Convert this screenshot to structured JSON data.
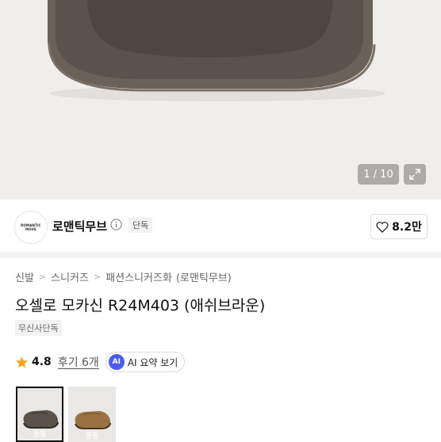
{
  "hero": {
    "image_counter": "1 / 10",
    "expand_icon": "expand-icon"
  },
  "brand": {
    "logo_text_line1": "ROMANTIC",
    "logo_text_line2": "MOVE",
    "name": "로맨틱무브",
    "info_icon": "info-icon",
    "badge": "단독"
  },
  "like": {
    "icon": "heart-outline-icon",
    "count": "8.2만"
  },
  "breadcrumb": [
    "신발",
    "스니커즈",
    "패션스니커즈화",
    "(로맨틱무브)"
  ],
  "product": {
    "title": "오셀로 모카신 R24M403 (애쉬브라운)",
    "tag": "무신사단독"
  },
  "rating": {
    "star_icon": "star-icon",
    "value": "4.8",
    "review_link": "후기 6개",
    "ai_icon_text": "AI",
    "ai_button_label": "AI 요약 보기"
  },
  "color_options": [
    {
      "color_name": "ash-brown",
      "label": "품절",
      "color": "#5a534c",
      "selected": true
    },
    {
      "color_name": "tan",
      "label": "품절",
      "color": "#9a7242",
      "selected": false
    }
  ],
  "colors": {
    "hero_background": "#efeeec",
    "shoe_dark": "#5a534c",
    "shoe_tan": "#9a7242",
    "ai_accent": "#4a5cf0",
    "star": "#f5a623"
  }
}
